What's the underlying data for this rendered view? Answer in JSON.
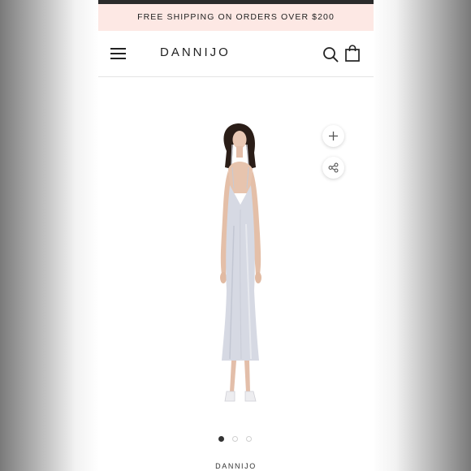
{
  "promo": {
    "text": "FREE SHIPPING ON ORDERS OVER $200"
  },
  "header": {
    "brand": "DANNIJO",
    "icons": {
      "menu": "hamburger-menu-icon",
      "search": "search-icon",
      "cart": "shopping-bag-icon"
    }
  },
  "product": {
    "image": "model-in-silver-satin-slip-dress",
    "gallery": {
      "count": 3,
      "active_index": 0
    },
    "actions": {
      "zoom": "plus-icon",
      "share": "share-icon"
    },
    "vendor": "DANNIJO"
  },
  "colors": {
    "promo_bg": "#fde8e4",
    "dress": "#d6d9e3",
    "text": "#222222"
  }
}
